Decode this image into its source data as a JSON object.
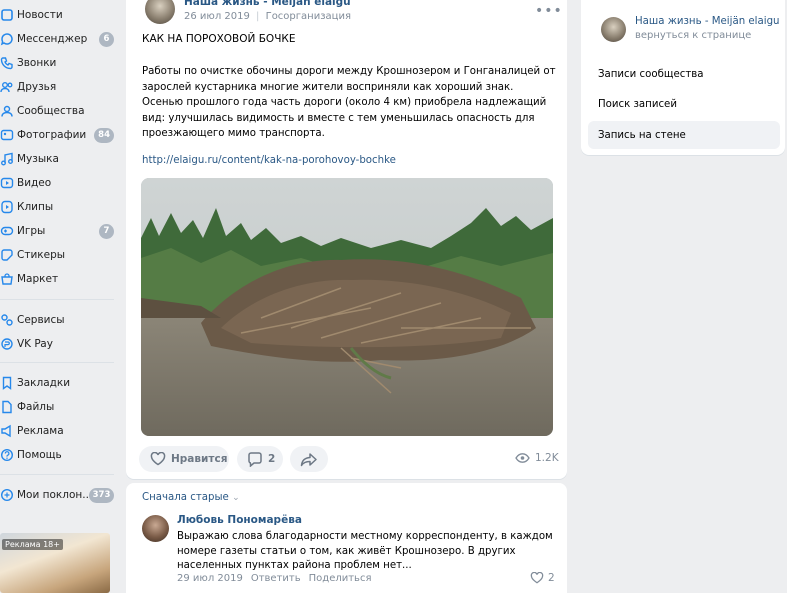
{
  "sidebar": {
    "items": [
      {
        "label": "Новости",
        "icon": "news-icon",
        "count": ""
      },
      {
        "label": "Мессенджер",
        "icon": "chat-icon",
        "count": "6"
      },
      {
        "label": "Звонки",
        "icon": "phone-icon",
        "count": ""
      },
      {
        "label": "Друзья",
        "icon": "friends-icon",
        "count": ""
      },
      {
        "label": "Сообщества",
        "icon": "community-icon",
        "count": ""
      },
      {
        "label": "Фотографии",
        "icon": "photo-icon",
        "count": "84"
      },
      {
        "label": "Музыка",
        "icon": "music-icon",
        "count": ""
      },
      {
        "label": "Видео",
        "icon": "video-icon",
        "count": ""
      },
      {
        "label": "Клипы",
        "icon": "clips-icon",
        "count": ""
      },
      {
        "label": "Игры",
        "icon": "games-icon",
        "count": "7"
      },
      {
        "label": "Стикеры",
        "icon": "stickers-icon",
        "count": ""
      },
      {
        "label": "Маркет",
        "icon": "market-icon",
        "count": ""
      },
      {
        "label": "Сервисы",
        "icon": "services-icon",
        "count": ""
      },
      {
        "label": "VK Pay",
        "icon": "vkpay-icon",
        "count": ""
      },
      {
        "label": "Закладки",
        "icon": "bookmarks-icon",
        "count": ""
      },
      {
        "label": "Файлы",
        "icon": "files-icon",
        "count": ""
      },
      {
        "label": "Реклама",
        "icon": "ads-icon",
        "count": ""
      },
      {
        "label": "Помощь",
        "icon": "help-icon",
        "count": ""
      },
      {
        "label": "Мои поклон...",
        "icon": "fans-icon",
        "count": "373"
      }
    ],
    "ad_label": "Реклама 18+"
  },
  "post": {
    "author": "Наша жизнь - Meijän elaigu",
    "date": "26 июл 2019",
    "sep": "|",
    "org_type": "Госорганизация",
    "title": "КАК НА ПОРОХОВОЙ БОЧКЕ",
    "body": "Работы по очистке обочины дороги между Крошнозером и Гонганалицей от зарослей кустарника многие жители восприняли как хороший знак. Осенью прошлого года часть дороги (около 4 км) приобрела надлежащий вид: улучшилась видимость и вместе с тем уменьшилась опасность для проезжающего мимо транспорта.",
    "link": "http://elaigu.ru/content/kak-na-porohovoy-bochke",
    "like_label": "Нравится",
    "comments_count": "2",
    "views": "1.2K"
  },
  "comments": {
    "sort_label": "Сначала старые",
    "items": [
      {
        "author": "Любовь Пономарёва",
        "text": "Выражаю слова благодарности местному корреспонденту, в каждом номере газеты статьи о том, как живёт Крошнозеро. В других населенных пунктах района проблем нет...",
        "date": "29 июл 2019",
        "reply": "Ответить",
        "share": "Поделиться",
        "likes": "2"
      }
    ]
  },
  "right_panel": {
    "title": "Наша жизнь - Meijän elaigu",
    "back": "вернуться к странице",
    "items": [
      {
        "label": "Записи сообщества"
      },
      {
        "label": "Поиск записей"
      },
      {
        "label": "Запись на стене"
      }
    ]
  },
  "colors": {
    "accent": "#2a5885",
    "icon": "#2688eb",
    "muted": "#818c99",
    "background": "#edeef0"
  }
}
